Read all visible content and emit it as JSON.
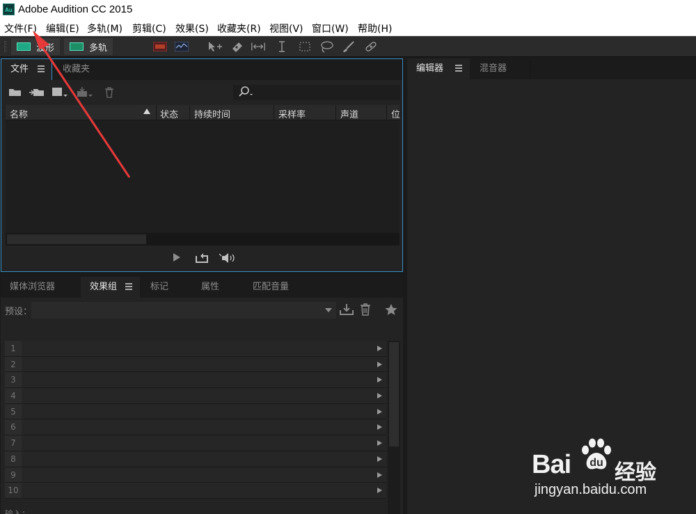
{
  "app": {
    "logo": "Au",
    "title": "Adobe Audition CC 2015"
  },
  "menu": [
    "文件(F)",
    "编辑(E)",
    "多轨(M)",
    "剪辑(C)",
    "效果(S)",
    "收藏夹(R)",
    "视图(V)",
    "窗口(W)",
    "帮助(H)"
  ],
  "toolbar": {
    "waveform_label": "波形",
    "multitrack_label": "多轨"
  },
  "files_panel": {
    "tabs": [
      "文件",
      "收藏夹"
    ],
    "columns": [
      "名称",
      "状态",
      "持续时间",
      "采样率",
      "声道",
      "位"
    ]
  },
  "right_panel": {
    "tabs": [
      "编辑器",
      "混音器"
    ]
  },
  "effects_panel": {
    "tabs": [
      "媒体浏览器",
      "效果组",
      "标记",
      "属性",
      "匹配音量"
    ],
    "preset_label": "预设：",
    "rack_rows": [
      "1",
      "2",
      "3",
      "4",
      "5",
      "6",
      "7",
      "8",
      "9",
      "10"
    ],
    "footer": "输入："
  },
  "watermark": {
    "brand_left": "Bai",
    "brand_right": "经验",
    "url": "jingyan.baidu.com"
  },
  "colors": {
    "accent": "#3a8fc6",
    "annotation": "#e8393a",
    "panel_bg": "#232323"
  }
}
